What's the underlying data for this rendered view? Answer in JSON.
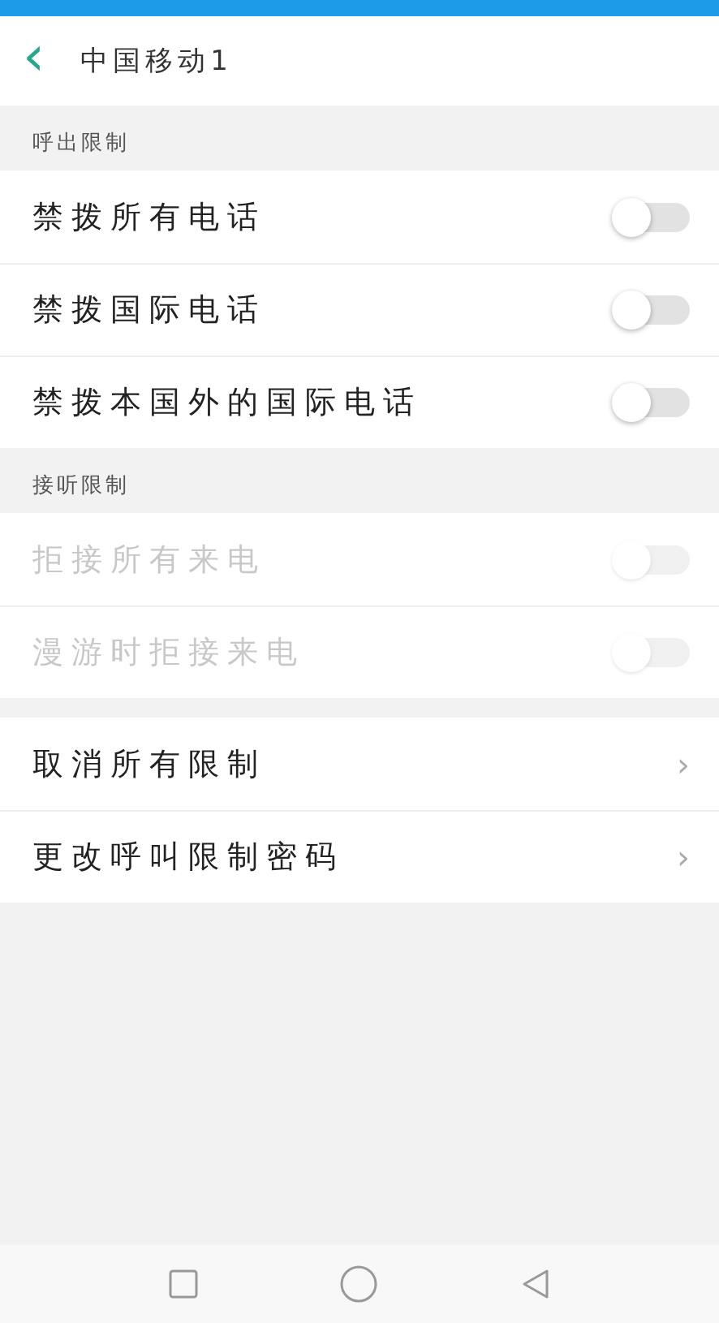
{
  "header": {
    "back_icon": "‹",
    "title": "中国移动1"
  },
  "sections": [
    {
      "title": "呼出限制",
      "rows": [
        {
          "kind": "toggle",
          "label": "禁拨所有电话",
          "on": false,
          "disabled": false
        },
        {
          "kind": "toggle",
          "label": "禁拨国际电话",
          "on": false,
          "disabled": false
        },
        {
          "kind": "toggle",
          "label": "禁拨本国外的国际电话",
          "on": false,
          "disabled": false
        }
      ]
    },
    {
      "title": "接听限制",
      "rows": [
        {
          "kind": "toggle",
          "label": "拒接所有来电",
          "on": false,
          "disabled": true
        },
        {
          "kind": "toggle",
          "label": "漫游时拒接来电",
          "on": false,
          "disabled": true
        }
      ]
    },
    {
      "rows": [
        {
          "kind": "link",
          "label": "取消所有限制",
          "chevron": "›"
        },
        {
          "kind": "link",
          "label": "更改呼叫限制密码",
          "chevron": "›"
        }
      ]
    }
  ]
}
